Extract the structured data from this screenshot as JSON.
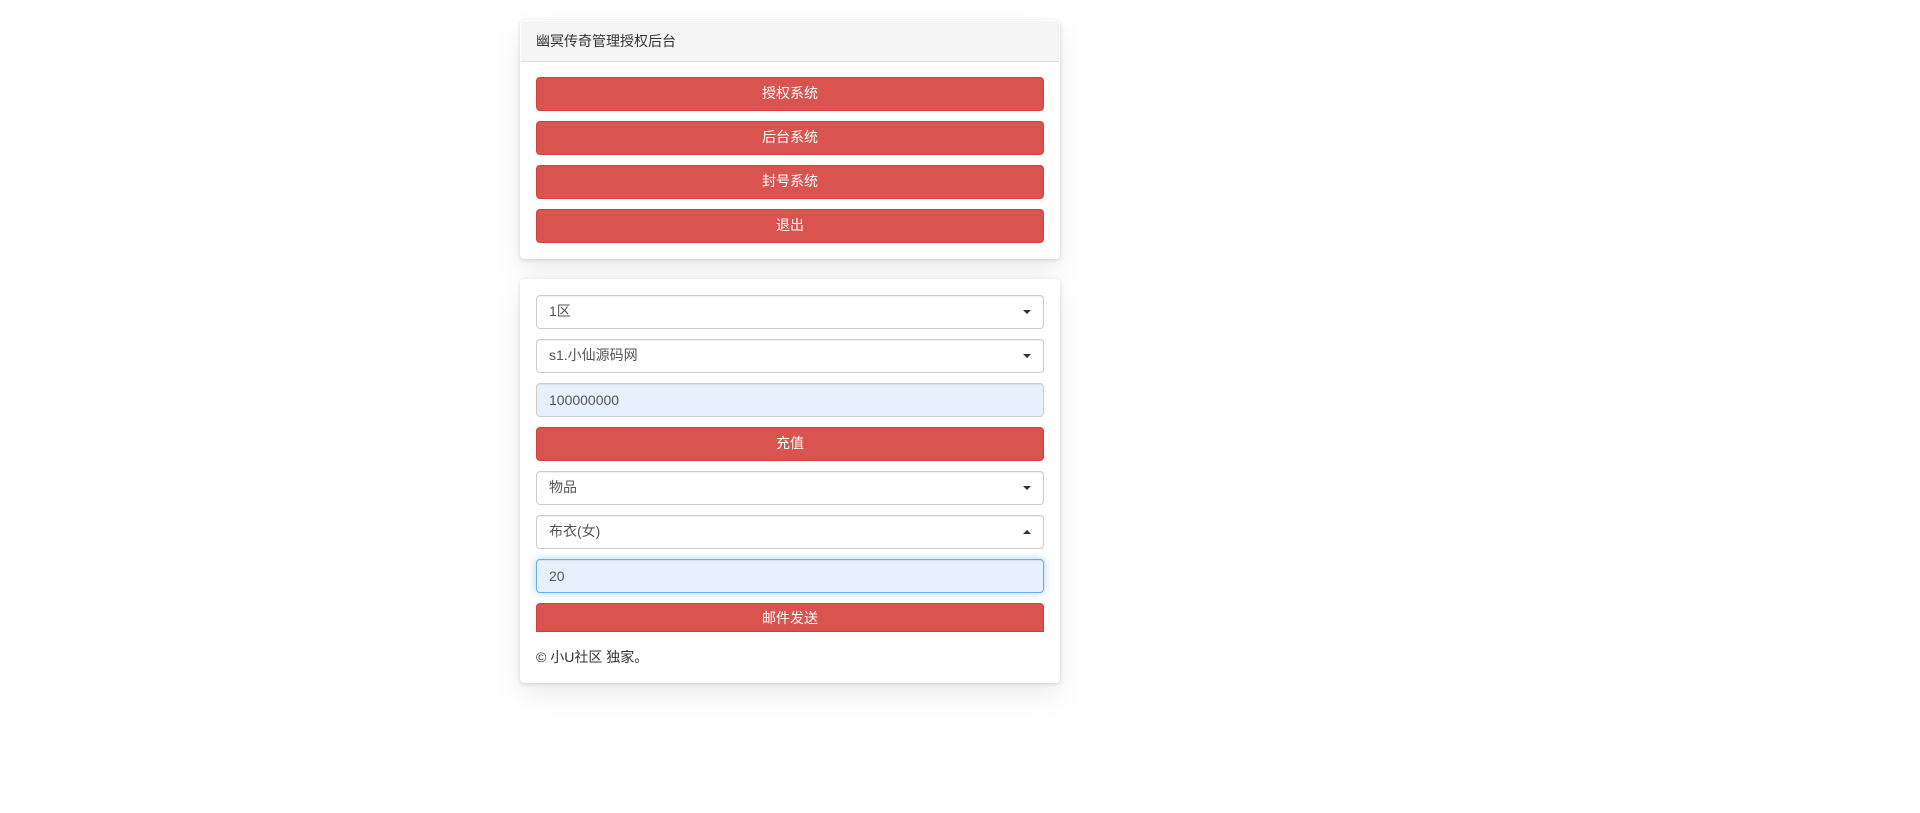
{
  "colors": {
    "danger": "#d9534f"
  },
  "header": {
    "title": "幽冥传奇管理授权后台"
  },
  "nav": {
    "auth": "授权系统",
    "admin": "后台系统",
    "ban": "封号系统",
    "logout": "退出"
  },
  "form": {
    "zone_selected": "1区",
    "server_selected": "s1.小仙源码网",
    "amount_value": "100000000",
    "recharge_label": "充值",
    "type_selected": "物品",
    "item_selected": "布衣(女)",
    "count_value": "20",
    "send_label": "邮件发送"
  },
  "footer": "© 小U社区 独家。"
}
